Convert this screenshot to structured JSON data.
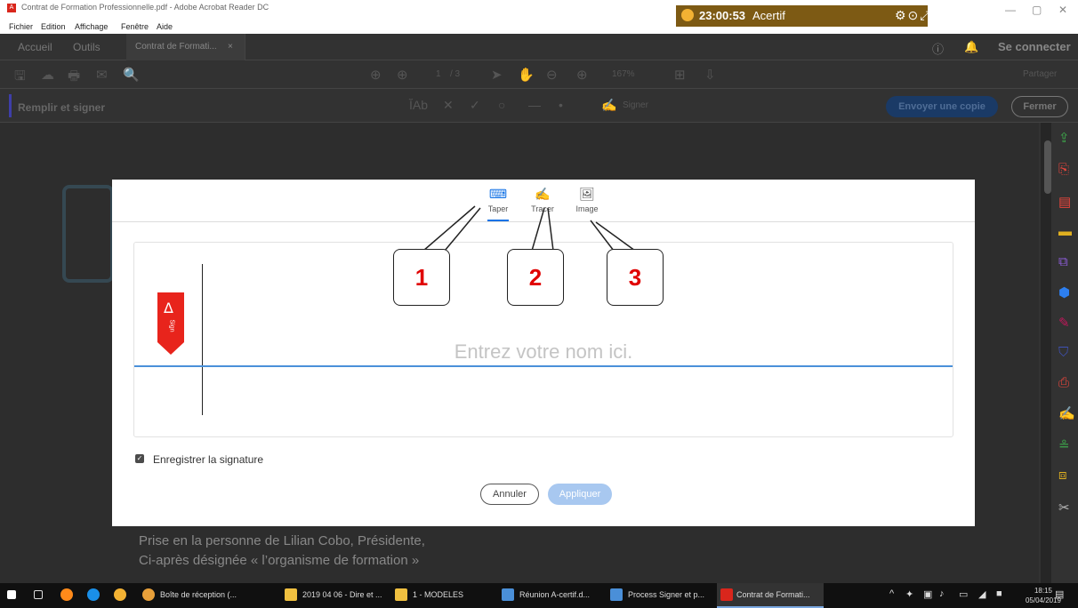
{
  "window": {
    "title": "Contrat de Formation Professionnelle.pdf - Adobe Acrobat Reader DC",
    "menu": [
      "Fichier",
      "Edition",
      "Affichage",
      "Fenêtre",
      "Aide"
    ]
  },
  "timer": {
    "time": "23:00:53",
    "brand": "Acertif"
  },
  "tabs": {
    "home": "Accueil",
    "tools": "Outils",
    "document": "Contrat de Formati...",
    "close_glyph": "×",
    "connect": "Se connecter"
  },
  "toolbar": {
    "page": "1",
    "pages": "/ 3",
    "zoom": "167%",
    "share": "Partager"
  },
  "fill_sign": {
    "label": "Remplir et signer",
    "text_tool": "Ab",
    "sign": "Signer",
    "send_copy": "Envoyer une copie",
    "close": "Fermer"
  },
  "modal": {
    "tabs": [
      {
        "label": "Taper",
        "icon": "keyboard-icon"
      },
      {
        "label": "Tracer",
        "icon": "pen-icon"
      },
      {
        "label": "Image",
        "icon": "image-icon"
      }
    ],
    "placeholder": "Entrez votre nom ici.",
    "ribbon_text": "Sign",
    "save_label": "Enregistrer la signature",
    "save_checked": true,
    "cancel": "Annuler",
    "apply": "Appliquer"
  },
  "callouts": [
    "1",
    "2",
    "3"
  ],
  "document_text": [
    "Prise en la personne de Lilian Cobo, Présidente,",
    "Ci-après désignée « l’organisme de formation »"
  ],
  "taskbar": {
    "items": [
      {
        "label": "Boîte de réception (...",
        "color": "#e8a03a"
      },
      {
        "label": "2019 04 06 - Dire et ...",
        "color": "#f0c040"
      },
      {
        "label": "1 - MODELES",
        "color": "#f0c040"
      },
      {
        "label": "Réunion A-certif.d...",
        "color": "#4a8fd8"
      },
      {
        "label": "Process Signer et p...",
        "color": "#4a8fd8"
      },
      {
        "label": "Contrat de Formati...",
        "color": "#d9261c"
      }
    ],
    "clock_time": "18:15",
    "clock_date": "05/04/2019"
  }
}
